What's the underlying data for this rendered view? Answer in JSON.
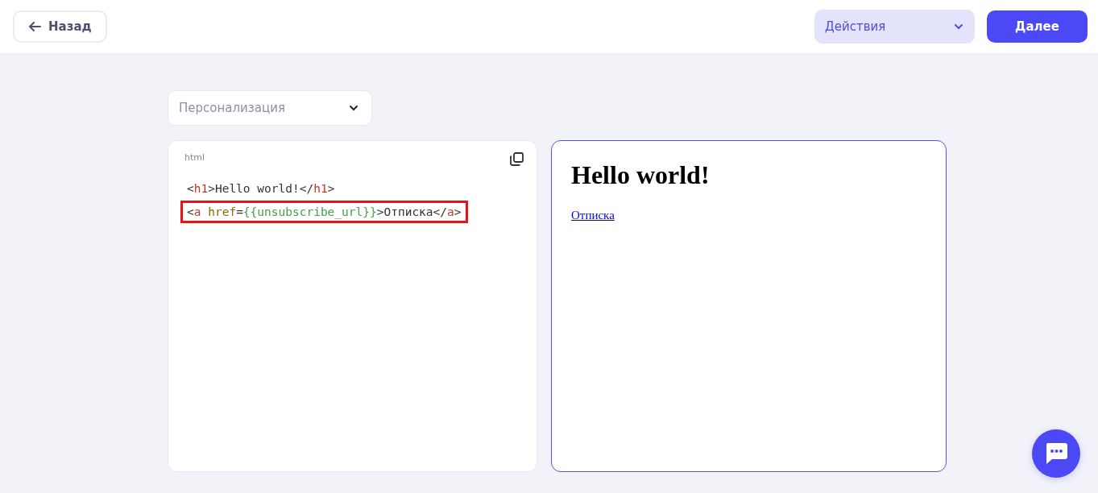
{
  "header": {
    "back_button": "Назад",
    "actions_menu": "Действия",
    "next_button": "Далее"
  },
  "personalization": {
    "value": "Персонализация"
  },
  "editor": {
    "language": "html",
    "lines": [
      {
        "highlighted": false,
        "tokens": [
          {
            "kind": "punct",
            "text": "<"
          },
          {
            "kind": "tag",
            "text": "h1"
          },
          {
            "kind": "punct",
            "text": ">Hello world!</"
          },
          {
            "kind": "tag",
            "text": "h1"
          },
          {
            "kind": "punct",
            "text": ">"
          }
        ]
      },
      {
        "highlighted": true,
        "tokens": [
          {
            "kind": "punct",
            "text": "<"
          },
          {
            "kind": "tag",
            "text": "a"
          },
          {
            "kind": "attr",
            "text": " href"
          },
          {
            "kind": "punct",
            "text": "="
          },
          {
            "kind": "var",
            "text": "{{unsubscribe_url}}"
          },
          {
            "kind": "punct",
            "text": ">Отписка</"
          },
          {
            "kind": "tag",
            "text": "a"
          },
          {
            "kind": "punct",
            "text": ">"
          }
        ]
      }
    ]
  },
  "preview": {
    "heading": "Hello world!",
    "link": "Отписка"
  }
}
